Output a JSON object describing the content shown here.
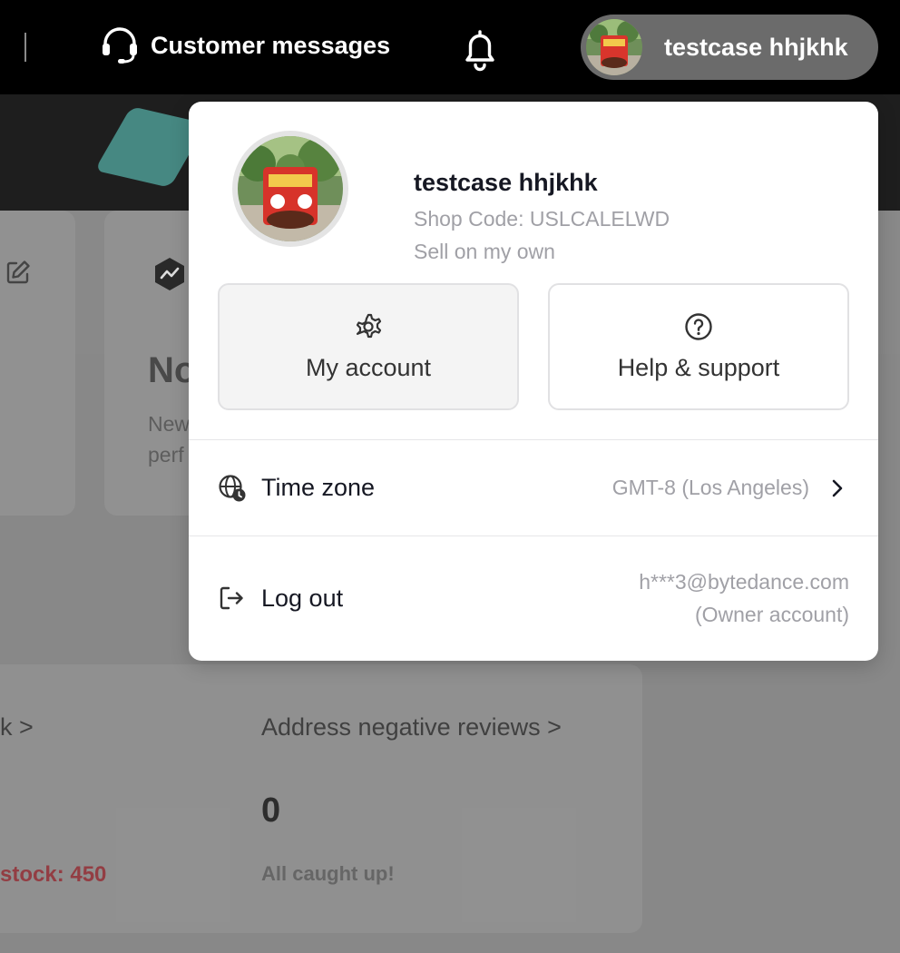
{
  "topbar": {
    "customer_messages_label": "Customer messages",
    "user_name": "testcase hhjkhk"
  },
  "background": {
    "card_title_partial": "No",
    "card_sub_line1_partial": "New",
    "card_sub_line2_partial": "perf",
    "left_link_partial": "k >",
    "negative_reviews_link": "Address negative reviews >",
    "negative_reviews_count": "0",
    "stock_text_partial": "stock: 450",
    "caught_up_text": "All caught up!"
  },
  "profile": {
    "name": "testcase hhjkhk",
    "shop_code": "Shop Code: USLCALELWD",
    "mode": "Sell on my own"
  },
  "tiles": {
    "my_account": "My account",
    "help_support": "Help & support"
  },
  "time_zone": {
    "label": "Time zone",
    "value": "GMT-8 (Los Angeles)"
  },
  "logout": {
    "label": "Log out",
    "email": "h***3@bytedance.com",
    "role": "(Owner account)"
  },
  "colors": {
    "topbar_bg": "#000000",
    "pill_bg": "#6b6b6b",
    "accent_teal": "#3fa79e",
    "stock_red": "#9c2a32"
  },
  "icons": [
    "headset-icon",
    "bell-icon",
    "gear-icon",
    "question-circle-icon",
    "globe-clock-icon",
    "chevron-right-icon",
    "logout-icon",
    "edit-icon",
    "hex-chart-icon"
  ]
}
